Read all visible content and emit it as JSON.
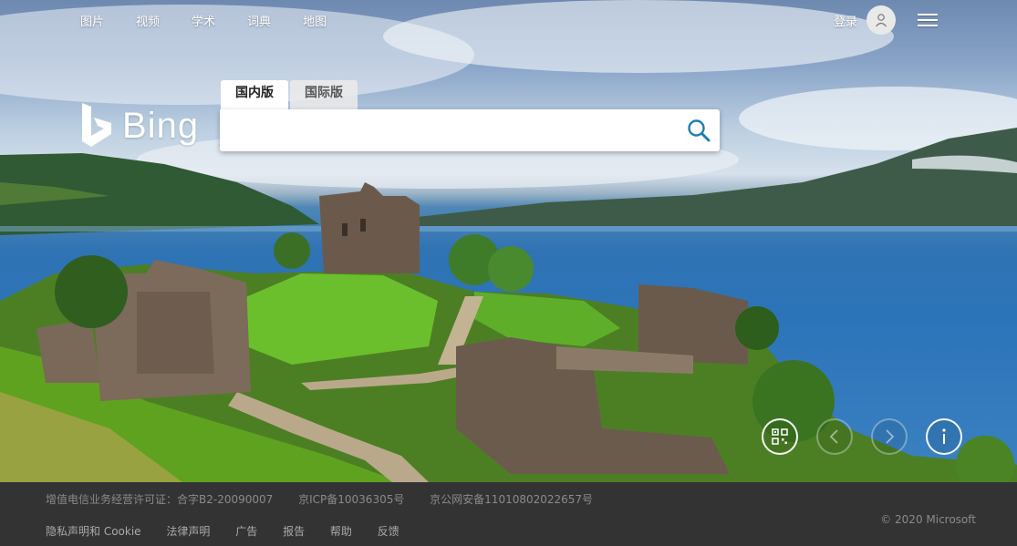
{
  "topnav": {
    "items": [
      "图片",
      "视频",
      "学术",
      "词典",
      "地图"
    ]
  },
  "header": {
    "login_label": "登录"
  },
  "logo": {
    "text": "Bing"
  },
  "tabs": {
    "domestic": "国内版",
    "international": "国际版"
  },
  "search": {
    "value": "",
    "placeholder": ""
  },
  "controls": [
    "qr-code-icon",
    "previous-icon",
    "next-icon",
    "info-icon"
  ],
  "footer": {
    "licenses": [
      "增值电信业务经营许可证：合字B2-20090007",
      "京ICP备10036305号",
      "京公网安备11010802022657号"
    ],
    "links": [
      "隐私声明和 Cookie",
      "法律声明",
      "广告",
      "报告",
      "帮助",
      "反馈"
    ],
    "copyright": "© 2020 Microsoft"
  },
  "colors": {
    "search_accent": "#1f7fb0",
    "footer_bg": "#333333"
  }
}
